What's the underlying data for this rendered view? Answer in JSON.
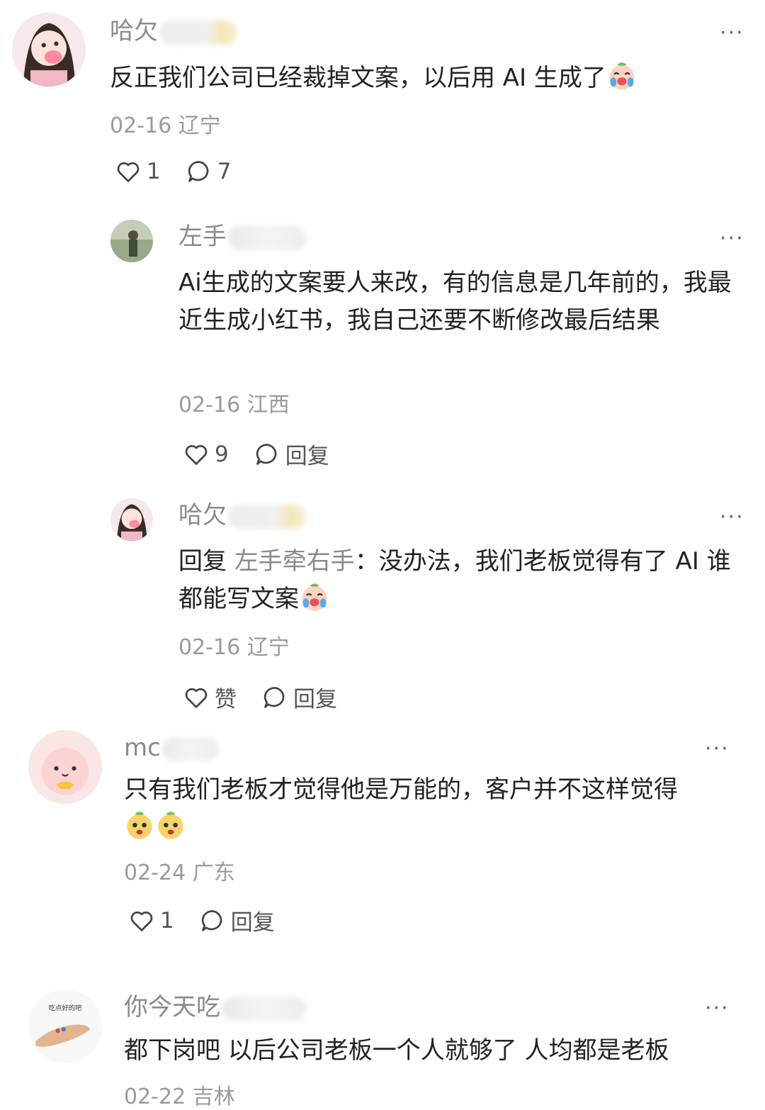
{
  "comments": [
    {
      "name": "哈欠",
      "text": "反正我们公司已经裁掉文案，以后用 AI 生成了",
      "emoji": "crying-emoji",
      "date": "02-16",
      "location": "辽宁",
      "likes": "1",
      "replies": "7"
    },
    {
      "name": "左手",
      "text": "Ai生成的文案要人来改，有的信息是几年前的，我最近生成小红书，我自己还要不断修改最后结果",
      "date": "02-16",
      "location": "江西",
      "likes": "9",
      "replies": "回复"
    },
    {
      "name": "哈欠",
      "reply_prefix": "回复",
      "reply_target": "左手牵右手",
      "text": "：没办法，我们老板觉得有了 AI 谁都能写文案",
      "emoji": "crying-emoji",
      "date": "02-16",
      "location": "辽宁",
      "likes": "赞",
      "replies": "回复"
    },
    {
      "name": "mc",
      "text": "只有我们老板才觉得他是万能的，客户并不这样觉得",
      "emoji": "sly-emoji",
      "date": "02-24",
      "location": "广东",
      "likes": "1",
      "replies": "回复"
    },
    {
      "name": "你今天吃",
      "avatar_text": "吃点好的吧",
      "text": "都下岗吧 以后公司老板一个人就够了 人均都是老板",
      "date": "02-22",
      "location": "吉林"
    }
  ],
  "more_label": "···",
  "colors": {
    "name": "#8a8a8a",
    "meta": "#9a9a9a",
    "text": "#222222"
  }
}
